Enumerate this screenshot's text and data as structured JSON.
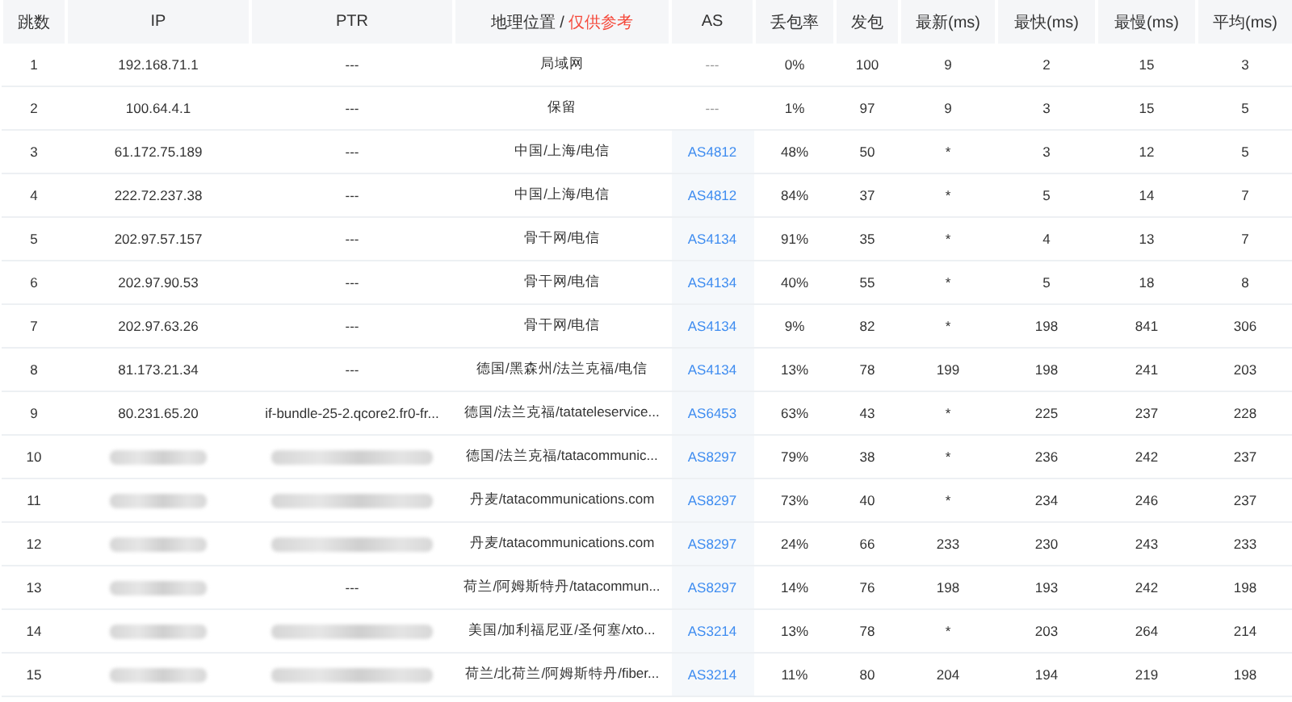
{
  "table": {
    "columns": [
      {
        "label": "跳数"
      },
      {
        "label": "IP"
      },
      {
        "label": "PTR"
      },
      {
        "label": "地理位置 /",
        "note": "仅供参考"
      },
      {
        "label": "AS"
      },
      {
        "label": "丢包率"
      },
      {
        "label": "发包"
      },
      {
        "label": "最新(ms)"
      },
      {
        "label": "最快(ms)"
      },
      {
        "label": "最慢(ms)"
      },
      {
        "label": "平均(ms)"
      }
    ],
    "rows": [
      {
        "hop": "1",
        "ip": "192.168.71.1",
        "ptr": "---",
        "geo": "局域网",
        "as": "---",
        "as_link": false,
        "loss": "0%",
        "sent": "100",
        "latest": "9",
        "fastest": "2",
        "slowest": "15",
        "avg": "3"
      },
      {
        "hop": "2",
        "ip": "100.64.4.1",
        "ptr": "---",
        "geo": "保留",
        "as": "---",
        "as_link": false,
        "loss": "1%",
        "sent": "97",
        "latest": "9",
        "fastest": "3",
        "slowest": "15",
        "avg": "5"
      },
      {
        "hop": "3",
        "ip": "61.172.75.189",
        "ptr": "---",
        "geo": "中国/上海/电信",
        "as": "AS4812",
        "as_link": true,
        "loss": "48%",
        "sent": "50",
        "latest": "*",
        "fastest": "3",
        "slowest": "12",
        "avg": "5"
      },
      {
        "hop": "4",
        "ip": "222.72.237.38",
        "ptr": "---",
        "geo": "中国/上海/电信",
        "as": "AS4812",
        "as_link": true,
        "loss": "84%",
        "sent": "37",
        "latest": "*",
        "fastest": "5",
        "slowest": "14",
        "avg": "7"
      },
      {
        "hop": "5",
        "ip": "202.97.57.157",
        "ptr": "---",
        "geo": "骨干网/电信",
        "as": "AS4134",
        "as_link": true,
        "loss": "91%",
        "sent": "35",
        "latest": "*",
        "fastest": "4",
        "slowest": "13",
        "avg": "7"
      },
      {
        "hop": "6",
        "ip": "202.97.90.53",
        "ptr": "---",
        "geo": "骨干网/电信",
        "as": "AS4134",
        "as_link": true,
        "loss": "40%",
        "sent": "55",
        "latest": "*",
        "fastest": "5",
        "slowest": "18",
        "avg": "8"
      },
      {
        "hop": "7",
        "ip": "202.97.63.26",
        "ptr": "---",
        "geo": "骨干网/电信",
        "as": "AS4134",
        "as_link": true,
        "loss": "9%",
        "sent": "82",
        "latest": "*",
        "fastest": "198",
        "slowest": "841",
        "avg": "306"
      },
      {
        "hop": "8",
        "ip": "81.173.21.34",
        "ptr": "---",
        "geo": "德国/黑森州/法兰克福/电信",
        "as": "AS4134",
        "as_link": true,
        "loss": "13%",
        "sent": "78",
        "latest": "199",
        "fastest": "198",
        "slowest": "241",
        "avg": "203"
      },
      {
        "hop": "9",
        "ip": "80.231.65.20",
        "ptr": "if-bundle-25-2.qcore2.fr0-fr...",
        "geo": "德国/法兰克福/tatateleservice...",
        "as": "AS6453",
        "as_link": true,
        "loss": "63%",
        "sent": "43",
        "latest": "*",
        "fastest": "225",
        "slowest": "237",
        "avg": "228"
      },
      {
        "hop": "10",
        "ip_redacted": true,
        "ptr_redacted": true,
        "geo": "德国/法兰克福/tatacommunic...",
        "as": "AS8297",
        "as_link": true,
        "loss": "79%",
        "sent": "38",
        "latest": "*",
        "fastest": "236",
        "slowest": "242",
        "avg": "237"
      },
      {
        "hop": "11",
        "ip_redacted": true,
        "ptr_redacted": true,
        "geo": "丹麦/tatacommunications.com",
        "as": "AS8297",
        "as_link": true,
        "loss": "73%",
        "sent": "40",
        "latest": "*",
        "fastest": "234",
        "slowest": "246",
        "avg": "237"
      },
      {
        "hop": "12",
        "ip_redacted": true,
        "ptr_redacted": true,
        "geo": "丹麦/tatacommunications.com",
        "as": "AS8297",
        "as_link": true,
        "loss": "24%",
        "sent": "66",
        "latest": "233",
        "fastest": "230",
        "slowest": "243",
        "avg": "233"
      },
      {
        "hop": "13",
        "ip_redacted": true,
        "ptr": "---",
        "geo": "荷兰/阿姆斯特丹/tatacommun...",
        "as": "AS8297",
        "as_link": true,
        "loss": "14%",
        "sent": "76",
        "latest": "198",
        "fastest": "193",
        "slowest": "242",
        "avg": "198"
      },
      {
        "hop": "14",
        "ip_redacted": true,
        "ptr_redacted": true,
        "geo": "美国/加利福尼亚/圣何塞/xto...",
        "as": "AS3214",
        "as_link": true,
        "loss": "13%",
        "sent": "78",
        "latest": "*",
        "fastest": "203",
        "slowest": "264",
        "avg": "214"
      },
      {
        "hop": "15",
        "ip_redacted": true,
        "ptr_redacted": true,
        "geo": "荷兰/北荷兰/阿姆斯特丹/fiber...",
        "as": "AS3214",
        "as_link": true,
        "loss": "11%",
        "sent": "80",
        "latest": "204",
        "fastest": "194",
        "slowest": "219",
        "avg": "198"
      }
    ]
  }
}
